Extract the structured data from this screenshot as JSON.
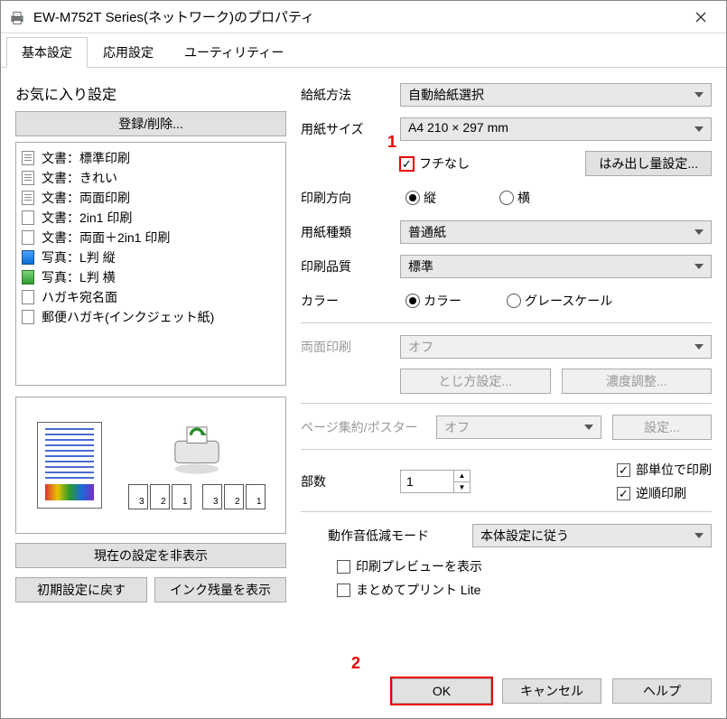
{
  "window": {
    "title": "EW-M752T Series(ネットワーク)のプロパティ"
  },
  "tabs": {
    "basic": "基本設定",
    "advanced": "応用設定",
    "utility": "ユーティリティー"
  },
  "favorites": {
    "title": "お気に入り設定",
    "register_btn": "登録/削除...",
    "items": [
      {
        "label": "文書：標準印刷",
        "icon": "sheet-lines"
      },
      {
        "label": "文書：きれい",
        "icon": "sheet-lines"
      },
      {
        "label": "文書：両面印刷",
        "icon": "sheet-dup"
      },
      {
        "label": "文書：2in1 印刷",
        "icon": "sheet-2in1"
      },
      {
        "label": "文書：両面＋2in1 印刷",
        "icon": "sheet-dup2"
      },
      {
        "label": "写真：L判 縦",
        "icon": "photo-blue"
      },
      {
        "label": "写真：L判 横",
        "icon": "photo-green"
      },
      {
        "label": "ハガキ宛名面",
        "icon": "hagaki"
      },
      {
        "label": "郵便ハガキ(インクジェット紙)",
        "icon": "hagaki-ij"
      }
    ],
    "hide_btn": "現在の設定を非表示",
    "reset_btn": "初期設定に戻す",
    "ink_btn": "インク残量を表示"
  },
  "settings": {
    "paper_source_lbl": "給紙方法",
    "paper_source": "自動給紙選択",
    "paper_size_lbl": "用紙サイズ",
    "paper_size": "A4 210 × 297 mm",
    "borderless_lbl": "フチなし",
    "bleed_btn": "はみ出し量設定...",
    "orient_lbl": "印刷方向",
    "orient_portrait": "縦",
    "orient_landscape": "横",
    "paper_type_lbl": "用紙種類",
    "paper_type": "普通紙",
    "quality_lbl": "印刷品質",
    "quality": "標準",
    "color_lbl": "カラー",
    "color_color": "カラー",
    "color_gray": "グレースケール",
    "duplex_lbl": "両面印刷",
    "duplex": "オフ",
    "binding_btn": "とじ方設定...",
    "density_btn": "濃度調整...",
    "layout_lbl": "ページ集約/ポスター",
    "layout": "オフ",
    "layout_cfg_btn": "設定...",
    "copies_lbl": "部数",
    "copies_value": "1",
    "collate_lbl": "部単位で印刷",
    "reverse_lbl": "逆順印刷",
    "quiet_lbl": "動作音低減モード",
    "quiet": "本体設定に従う",
    "preview_chk": "印刷プレビューを表示",
    "lite_chk": "まとめてプリント Lite"
  },
  "markers": {
    "one": "1",
    "two": "2"
  },
  "buttons": {
    "ok": "OK",
    "cancel": "キャンセル",
    "help": "ヘルプ"
  }
}
